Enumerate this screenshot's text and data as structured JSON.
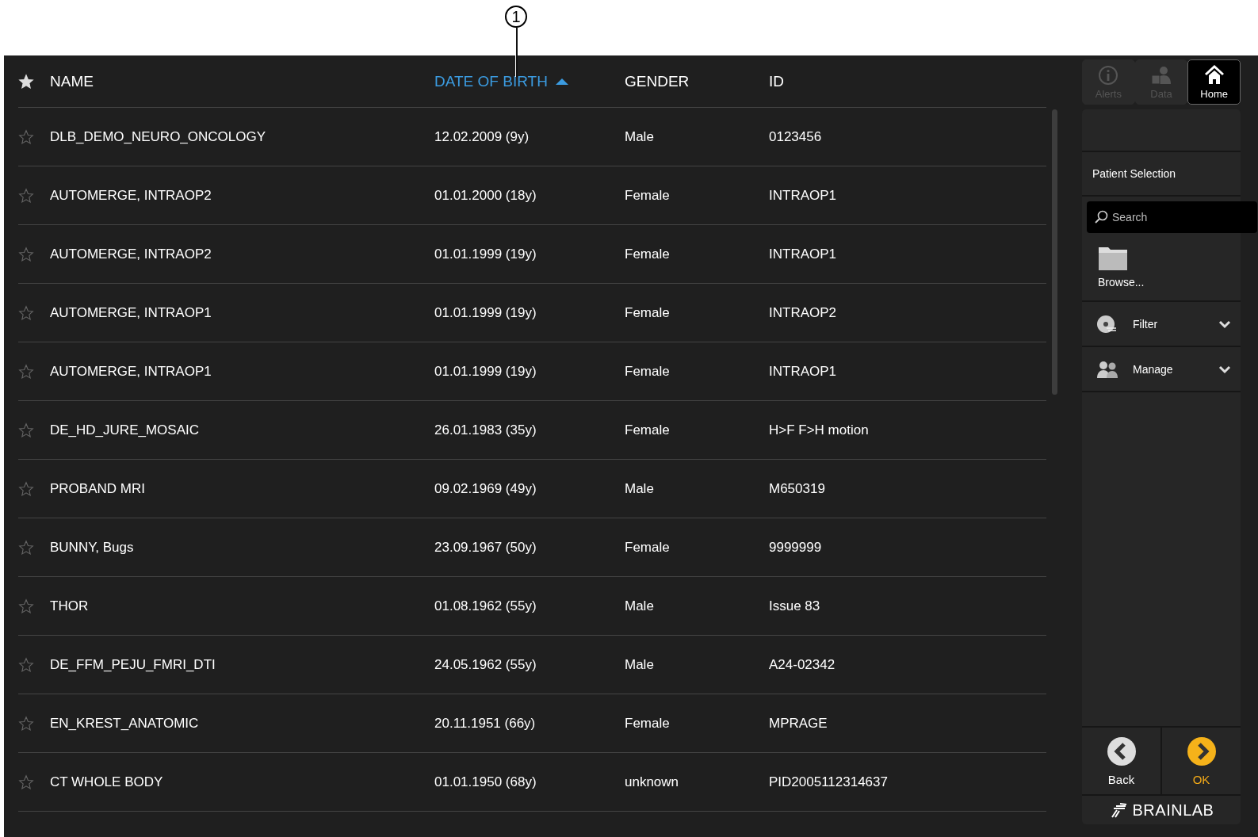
{
  "callout": {
    "label": "1"
  },
  "table": {
    "columns": [
      {
        "label": "NAME",
        "sorted": false
      },
      {
        "label": "DATE OF BIRTH",
        "sorted": true
      },
      {
        "label": "GENDER",
        "sorted": false
      },
      {
        "label": "ID",
        "sorted": false
      }
    ],
    "rows": [
      {
        "favorite": false,
        "name": "DLB_DEMO_NEURO_ONCOLOGY",
        "dob": "12.02.2009 (9y)",
        "gender": "Male",
        "id": "0123456"
      },
      {
        "favorite": false,
        "name": "AUTOMERGE, INTRAOP2",
        "dob": "01.01.2000 (18y)",
        "gender": "Female",
        "id": "INTRAOP1"
      },
      {
        "favorite": false,
        "name": "AUTOMERGE, INTRAOP2",
        "dob": "01.01.1999 (19y)",
        "gender": "Female",
        "id": "INTRAOP1"
      },
      {
        "favorite": false,
        "name": "AUTOMERGE, INTRAOP1",
        "dob": "01.01.1999 (19y)",
        "gender": "Female",
        "id": "INTRAOP2"
      },
      {
        "favorite": false,
        "name": "AUTOMERGE, INTRAOP1",
        "dob": "01.01.1999 (19y)",
        "gender": "Female",
        "id": "INTRAOP1"
      },
      {
        "favorite": false,
        "name": "DE_HD_JURE_MOSAIC",
        "dob": "26.01.1983 (35y)",
        "gender": "Female",
        "id": "H>F F>H motion"
      },
      {
        "favorite": false,
        "name": "PROBAND MRI",
        "dob": "09.02.1969 (49y)",
        "gender": "Male",
        "id": "M650319"
      },
      {
        "favorite": false,
        "name": "BUNNY, Bugs",
        "dob": "23.09.1967 (50y)",
        "gender": "Female",
        "id": "9999999"
      },
      {
        "favorite": false,
        "name": "THOR",
        "dob": "01.08.1962 (55y)",
        "gender": "Male",
        "id": "Issue 83"
      },
      {
        "favorite": false,
        "name": "DE_FFM_PEJU_FMRI_DTI",
        "dob": "24.05.1962 (55y)",
        "gender": "Male",
        "id": "A24-02342"
      },
      {
        "favorite": false,
        "name": "EN_KREST_ANATOMIC",
        "dob": "20.11.1951 (66y)",
        "gender": "Female",
        "id": "MPRAGE"
      },
      {
        "favorite": false,
        "name": "CT WHOLE BODY",
        "dob": "01.01.1950 (68y)",
        "gender": "unknown",
        "id": "PID2005112314637"
      }
    ]
  },
  "sidebar": {
    "tabs": [
      {
        "kind": "alerts",
        "label": "Alerts",
        "selected": false,
        "disabled": true
      },
      {
        "kind": "data",
        "label": "Data",
        "selected": false,
        "disabled": true
      },
      {
        "kind": "home",
        "label": "Home",
        "selected": true,
        "disabled": false
      }
    ],
    "title": "Patient Selection",
    "search": {
      "placeholder": "Search"
    },
    "browse": "Browse...",
    "sections": [
      {
        "kind": "filter",
        "label": "Filter",
        "expanded": false
      },
      {
        "kind": "manage",
        "label": "Manage",
        "expanded": false
      }
    ],
    "buttons": [
      {
        "kind": "back",
        "label": "Back"
      },
      {
        "kind": "ok",
        "label": "OK"
      }
    ],
    "logo": "BRAINLAB"
  }
}
